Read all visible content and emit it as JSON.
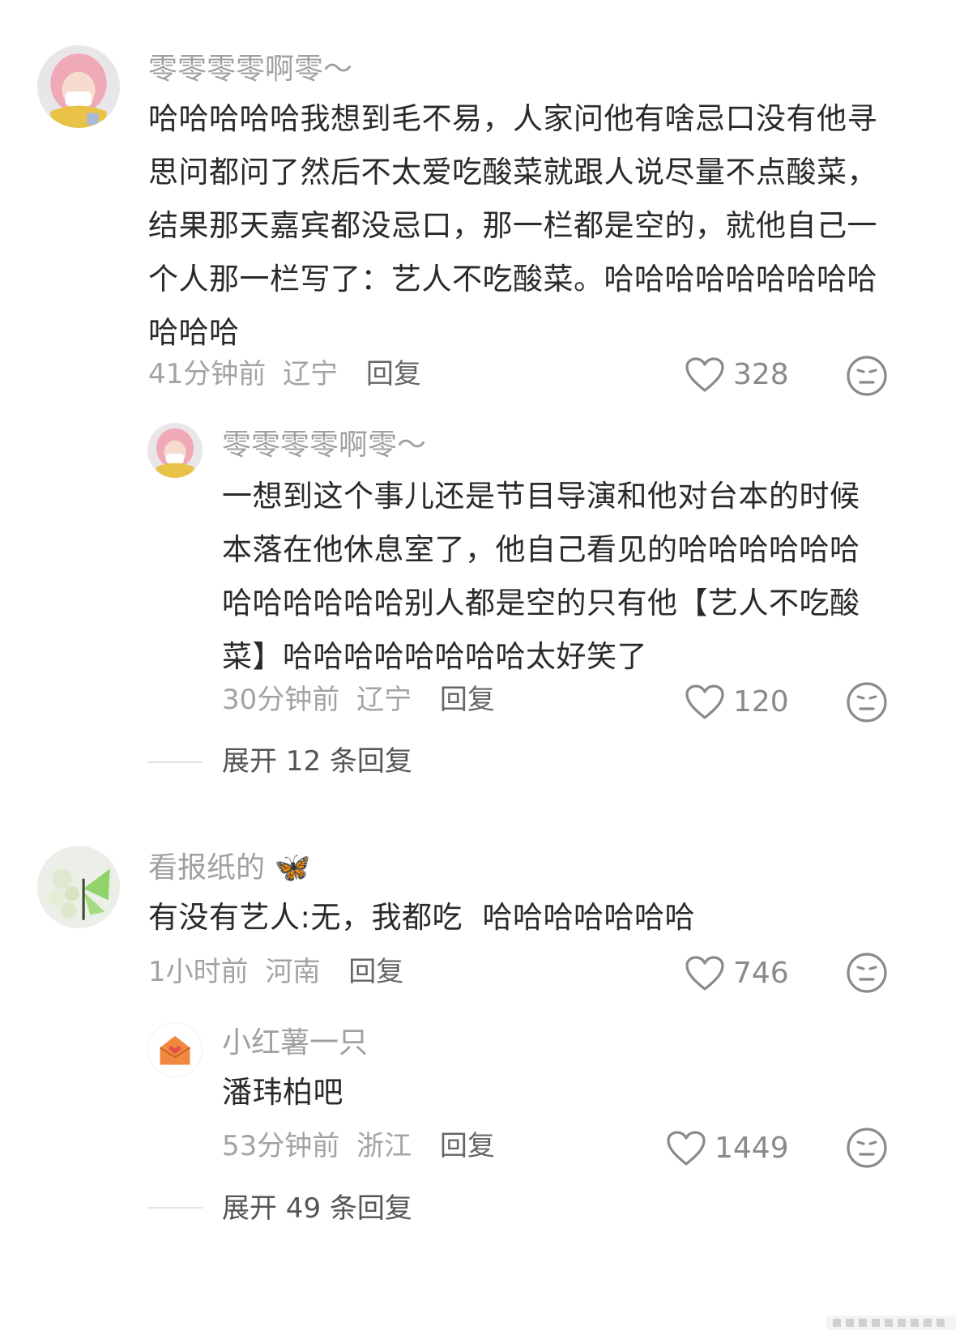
{
  "comments": [
    {
      "username": "零零零零啊零～",
      "text": "哈哈哈哈哈我想到毛不易，人家问他有啥忌口没有他寻思问都问了然后不太爱吃酸菜就跟人说尽量不点酸菜，结果那天嘉宾都没忌口，那一栏都是空的，就他自己一个人那一栏写了：艺人不吃酸菜。哈哈哈哈哈哈哈哈哈哈哈哈",
      "time": "41分钟前",
      "location": "辽宁",
      "reply_label": "回复",
      "likes": "328",
      "replies": [
        {
          "username": "零零零零啊零～",
          "text": "一想到这个事儿还是节目导演和他对台本的时候本落在他休息室了，他自己看见的哈哈哈哈哈哈哈哈哈哈哈哈别人都是空的只有他【艺人不吃酸菜】哈哈哈哈哈哈哈哈太好笑了",
          "time": "30分钟前",
          "location": "辽宁",
          "reply_label": "回复",
          "likes": "120"
        }
      ],
      "expand_label": "展开 12 条回复"
    },
    {
      "username": "看报纸的",
      "username_emoji": "🦋",
      "text": "有没有艺人:无，我都吃  哈哈哈哈哈哈哈",
      "time": "1小时前",
      "location": "河南",
      "reply_label": "回复",
      "likes": "746",
      "replies": [
        {
          "username": "小红薯一只",
          "text": "潘玮柏吧",
          "time": "53分钟前",
          "location": "浙江",
          "reply_label": "回复",
          "likes": "1449"
        }
      ],
      "expand_label": "展开 49 条回复"
    }
  ],
  "colors": {
    "username": "#a0a0a0",
    "meta": "#a3a3a3",
    "text": "#2a2a2a",
    "icon": "#8a8a8a"
  },
  "icons": {
    "like": "heart-outline-icon",
    "emoji": "neutral-face-icon"
  }
}
